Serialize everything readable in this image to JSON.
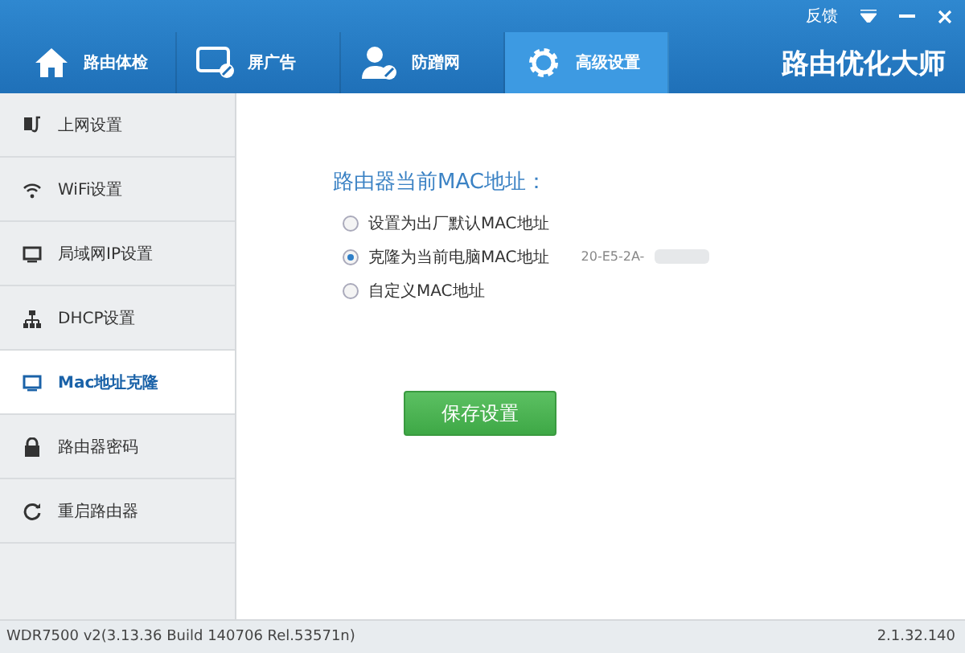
{
  "header": {
    "links": [
      "反馈"
    ],
    "tabs": [
      {
        "label": "路由体检",
        "kind": "home",
        "selected": false
      },
      {
        "label": "屏广告",
        "kind": "monitor",
        "selected": false
      },
      {
        "label": "防蹭网",
        "kind": "user",
        "selected": false
      },
      {
        "label": "高级设置",
        "kind": "gear",
        "selected": true
      }
    ],
    "brand": "路由优化大师"
  },
  "sidebar": {
    "items": [
      {
        "label": "上网设置",
        "kind": "plug",
        "selected": false
      },
      {
        "label": "WiFi设置",
        "kind": "wifi",
        "selected": false
      },
      {
        "label": "局域网IP设置",
        "kind": "screen",
        "selected": false
      },
      {
        "label": "DHCP设置",
        "kind": "network",
        "selected": false
      },
      {
        "label": "Mac地址克隆",
        "kind": "screen",
        "selected": true
      },
      {
        "label": "路由器密码",
        "kind": "lock",
        "selected": false
      },
      {
        "label": "重启路由器",
        "kind": "refresh",
        "selected": false
      }
    ]
  },
  "main": {
    "heading": "路由器当前MAC地址：",
    "options": [
      {
        "label": "设置为出厂默认MAC地址",
        "selected": false
      },
      {
        "label": "克隆为当前电脑MAC地址",
        "selected": true,
        "value": "20-E5-2A-"
      },
      {
        "label": "自定义MAC地址",
        "selected": false
      }
    ],
    "save_button": "保存设置"
  },
  "status_bar": {
    "firmware": "WDR7500 v2(3.13.36 Build 140706 Rel.53571n)",
    "version": "2.1.32.140"
  }
}
